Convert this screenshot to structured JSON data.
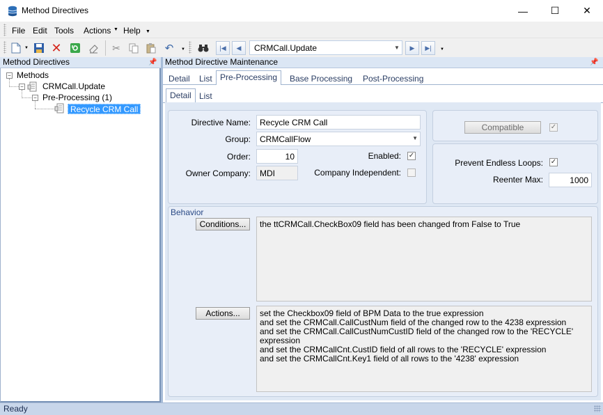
{
  "window": {
    "title": "Method Directives",
    "minimize": "—",
    "maximize": "☐",
    "close": "✕"
  },
  "menu": [
    "File",
    "Edit",
    "Tools",
    "Actions",
    "Help"
  ],
  "toolbar": {
    "combo_value": "CRMCall.Update"
  },
  "left_panel": {
    "title": "Method Directives",
    "tree": {
      "root": "Methods",
      "method": "CRMCall.Update",
      "group": "Pre-Processing (1)",
      "selected": "Recycle CRM Call"
    }
  },
  "right_panel": {
    "title": "Method Directive Maintenance",
    "tabs": [
      "Detail",
      "List",
      "Pre-Processing",
      "Base Processing",
      "Post-Processing"
    ],
    "subtabs": [
      "Detail",
      "List"
    ]
  },
  "form": {
    "directive_name_label": "Directive Name:",
    "directive_name": "Recycle CRM Call",
    "group_label": "Group:",
    "group": "CRMCallFlow",
    "order_label": "Order:",
    "order": "10",
    "enabled_label": "Enabled:",
    "owner_company_label": "Owner Company:",
    "owner_company": "MDI",
    "company_independent_label": "Company Independent:",
    "compatible_button": "Compatible",
    "prevent_loops_label": "Prevent Endless Loops:",
    "reenter_max_label": "Reenter Max:",
    "reenter_max": "1000"
  },
  "behavior": {
    "title": "Behavior",
    "conditions_button": "Conditions...",
    "conditions_text": "the ttCRMCall.CheckBox09 field has been changed from False to True",
    "actions_button": "Actions...",
    "actions_lines": [
      "set the Checkbox09 field of BPM Data to the  true  expression",
      "and set the CRMCall.CallCustNum field of the changed row to the 4238 expression",
      "and set the CRMCall.CallCustNumCustID field of the changed row to the 'RECYCLE'",
      "expression",
      "and set the CRMCallCnt.CustID field of all rows to the 'RECYCLE' expression",
      "and set the CRMCallCnt.Key1 field of all rows to the '4238' expression"
    ]
  },
  "status": "Ready"
}
